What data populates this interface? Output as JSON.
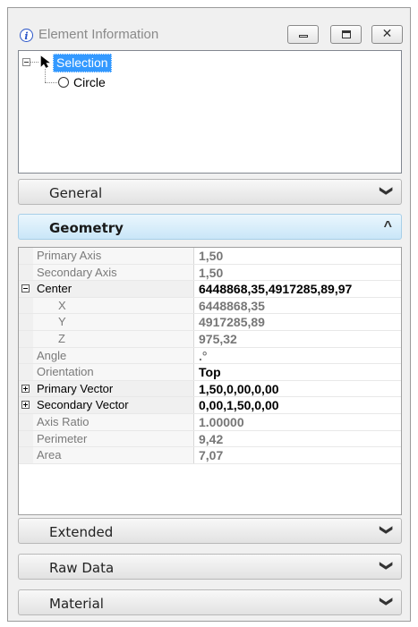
{
  "window": {
    "title": "Element Information",
    "info_icon": "i",
    "buttons": {
      "minimize": "minimize-icon",
      "restore": "restore-icon",
      "close": "close-icon"
    }
  },
  "tree": {
    "root_label": "Selection",
    "child_label": "Circle"
  },
  "sections": {
    "general": "General",
    "geometry": "Geometry",
    "extended": "Extended",
    "raw_data": "Raw Data",
    "material": "Material"
  },
  "properties": [
    {
      "name": "Primary Axis",
      "value": "1,50"
    },
    {
      "name": "Secondary Axis",
      "value": "1,50"
    },
    {
      "name": "Center",
      "value": "6448868,35,4917285,89,97"
    },
    {
      "name": "X",
      "value": "6448868,35"
    },
    {
      "name": "Y",
      "value": "4917285,89"
    },
    {
      "name": "Z",
      "value": "975,32"
    },
    {
      "name": "Angle",
      "value": ".°"
    },
    {
      "name": "Orientation",
      "value": "Top"
    },
    {
      "name": "Primary Vector",
      "value": "1,50,0,00,0,00"
    },
    {
      "name": "Secondary Vector",
      "value": "0,00,1,50,0,00"
    },
    {
      "name": "Axis Ratio",
      "value": "1.00000"
    },
    {
      "name": "Perimeter",
      "value": "9,42"
    },
    {
      "name": "Area",
      "value": "7,07"
    }
  ],
  "colors": {
    "selection_highlight": "#3399ff",
    "expanded_header": "#c9e6f8",
    "info_icon": "#2a55c8"
  }
}
